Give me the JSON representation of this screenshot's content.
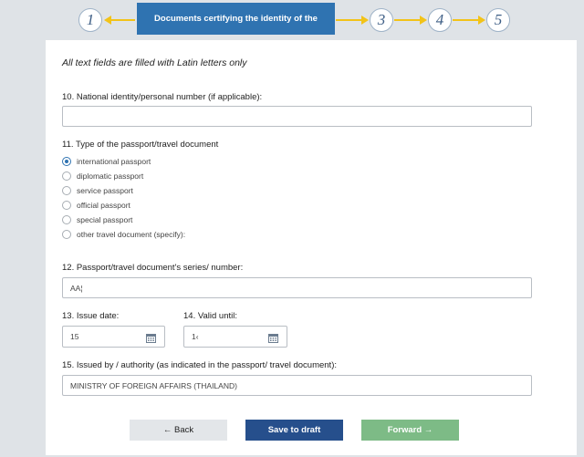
{
  "stepper": {
    "steps": [
      {
        "number": "1"
      },
      {
        "label": "Documents certifying the identity of the applicant"
      },
      {
        "number": "3"
      },
      {
        "number": "4"
      },
      {
        "number": "5"
      }
    ],
    "accent_color": "#2f73b1",
    "arrow_color": "#f2c318"
  },
  "form": {
    "note": "All text fields are filled with Latin letters only",
    "national_id": {
      "label": "10. National identity/personal number (if applicable):",
      "value": ""
    },
    "passport_type": {
      "label": "11. Type of the passport/travel document",
      "options": [
        "international passport",
        "diplomatic passport",
        "service passport",
        "official passport",
        "special passport",
        "other travel document (specify):"
      ],
      "selected": "international passport"
    },
    "series_number": {
      "label": "12. Passport/travel document's series/ number:",
      "value": "AA¦"
    },
    "issue_date": {
      "label": "13. Issue date:",
      "value": "15"
    },
    "valid_until": {
      "label": "14. Valid until:",
      "value": "1‹"
    },
    "issued_by": {
      "label": "15. Issued by / authority (as indicated in the passport/ travel document):",
      "value": "MINISTRY OF FOREIGN AFFAIRS (THAILAND)"
    }
  },
  "buttons": {
    "back": "← Back",
    "draft": "Save to draft",
    "forward": "Forward →"
  }
}
